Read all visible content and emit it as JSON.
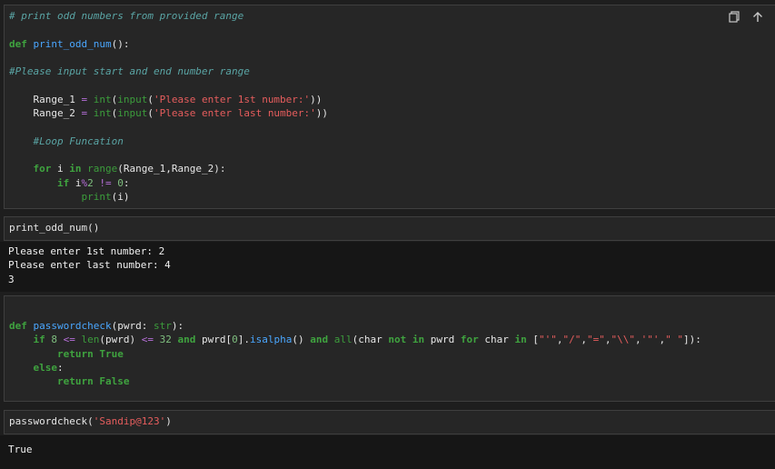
{
  "cell1": {
    "toolbar": {
      "copy_icon": "copy-icon",
      "move_up_icon": "arrow-up-icon"
    },
    "lines": [
      [
        {
          "t": "comment",
          "v": "# print odd numbers from provided range"
        }
      ],
      [],
      [
        {
          "t": "kw",
          "v": "def "
        },
        {
          "t": "fn",
          "v": "print_odd_num"
        },
        {
          "t": "plain",
          "v": "():"
        }
      ],
      [],
      [
        {
          "t": "comment",
          "v": "#Please input start and end number range"
        }
      ],
      [],
      [
        {
          "t": "plain",
          "v": "    Range_1 "
        },
        {
          "t": "op",
          "v": "="
        },
        {
          "t": "plain",
          "v": " "
        },
        {
          "t": "builtin",
          "v": "int"
        },
        {
          "t": "plain",
          "v": "("
        },
        {
          "t": "builtin",
          "v": "input"
        },
        {
          "t": "plain",
          "v": "("
        },
        {
          "t": "str",
          "v": "'Please enter 1st number:'"
        },
        {
          "t": "plain",
          "v": "))"
        }
      ],
      [
        {
          "t": "plain",
          "v": "    Range_2 "
        },
        {
          "t": "op",
          "v": "="
        },
        {
          "t": "plain",
          "v": " "
        },
        {
          "t": "builtin",
          "v": "int"
        },
        {
          "t": "plain",
          "v": "("
        },
        {
          "t": "builtin",
          "v": "input"
        },
        {
          "t": "plain",
          "v": "("
        },
        {
          "t": "str",
          "v": "'Please enter last number:'"
        },
        {
          "t": "plain",
          "v": "))"
        }
      ],
      [],
      [
        {
          "t": "comment",
          "v": "    #Loop Funcation"
        }
      ],
      [],
      [
        {
          "t": "kw",
          "v": "    for "
        },
        {
          "t": "plain",
          "v": "i "
        },
        {
          "t": "kw",
          "v": "in "
        },
        {
          "t": "builtin",
          "v": "range"
        },
        {
          "t": "plain",
          "v": "(Range_1,Range_2):"
        }
      ],
      [
        {
          "t": "kw",
          "v": "        if "
        },
        {
          "t": "plain",
          "v": "i"
        },
        {
          "t": "op",
          "v": "%"
        },
        {
          "t": "num",
          "v": "2"
        },
        {
          "t": "plain",
          "v": " "
        },
        {
          "t": "op",
          "v": "!="
        },
        {
          "t": "plain",
          "v": " "
        },
        {
          "t": "num",
          "v": "0"
        },
        {
          "t": "plain",
          "v": ":"
        }
      ],
      [
        {
          "t": "plain",
          "v": "            "
        },
        {
          "t": "builtin",
          "v": "print"
        },
        {
          "t": "plain",
          "v": "(i)"
        }
      ]
    ]
  },
  "cell2": {
    "lines": [
      [
        {
          "t": "plain",
          "v": "print_odd_num()"
        }
      ]
    ],
    "output": [
      "Please enter 1st number: 2",
      "Please enter last number: 4",
      "3"
    ]
  },
  "cell3": {
    "lines": [
      [],
      [
        {
          "t": "kw",
          "v": "def "
        },
        {
          "t": "fn",
          "v": "passwordcheck"
        },
        {
          "t": "plain",
          "v": "(pwrd: "
        },
        {
          "t": "builtin",
          "v": "str"
        },
        {
          "t": "plain",
          "v": "):"
        }
      ],
      [
        {
          "t": "kw",
          "v": "    if "
        },
        {
          "t": "num",
          "v": "8"
        },
        {
          "t": "plain",
          "v": " "
        },
        {
          "t": "op",
          "v": "<="
        },
        {
          "t": "plain",
          "v": " "
        },
        {
          "t": "builtin",
          "v": "len"
        },
        {
          "t": "plain",
          "v": "(pwrd) "
        },
        {
          "t": "op",
          "v": "<="
        },
        {
          "t": "plain",
          "v": " "
        },
        {
          "t": "num",
          "v": "32"
        },
        {
          "t": "plain",
          "v": " "
        },
        {
          "t": "kw",
          "v": "and"
        },
        {
          "t": "plain",
          "v": " pwrd["
        },
        {
          "t": "num",
          "v": "0"
        },
        {
          "t": "plain",
          "v": "]."
        },
        {
          "t": "fn",
          "v": "isalpha"
        },
        {
          "t": "plain",
          "v": "() "
        },
        {
          "t": "kw",
          "v": "and"
        },
        {
          "t": "plain",
          "v": " "
        },
        {
          "t": "builtin",
          "v": "all"
        },
        {
          "t": "plain",
          "v": "(char "
        },
        {
          "t": "kw",
          "v": "not in"
        },
        {
          "t": "plain",
          "v": " pwrd "
        },
        {
          "t": "kw",
          "v": "for"
        },
        {
          "t": "plain",
          "v": " char "
        },
        {
          "t": "kw",
          "v": "in"
        },
        {
          "t": "plain",
          "v": " ["
        },
        {
          "t": "str",
          "v": "\"'\""
        },
        {
          "t": "plain",
          "v": ","
        },
        {
          "t": "str",
          "v": "\"/\""
        },
        {
          "t": "plain",
          "v": ","
        },
        {
          "t": "str",
          "v": "\"=\""
        },
        {
          "t": "plain",
          "v": ","
        },
        {
          "t": "str",
          "v": "\"\\\\\""
        },
        {
          "t": "plain",
          "v": ","
        },
        {
          "t": "str",
          "v": "'\"'"
        },
        {
          "t": "plain",
          "v": ","
        },
        {
          "t": "str",
          "v": "\" \""
        },
        {
          "t": "plain",
          "v": "]):"
        }
      ],
      [
        {
          "t": "kw",
          "v": "        return True"
        }
      ],
      [
        {
          "t": "kw",
          "v": "    else"
        },
        {
          "t": "plain",
          "v": ":"
        }
      ],
      [
        {
          "t": "kw",
          "v": "        return False"
        }
      ]
    ]
  },
  "cell4": {
    "lines": [
      [
        {
          "t": "plain",
          "v": "passwordcheck("
        },
        {
          "t": "str",
          "v": "'Sandip@123'"
        },
        {
          "t": "plain",
          "v": ")"
        }
      ]
    ],
    "output": [
      "True"
    ]
  }
}
